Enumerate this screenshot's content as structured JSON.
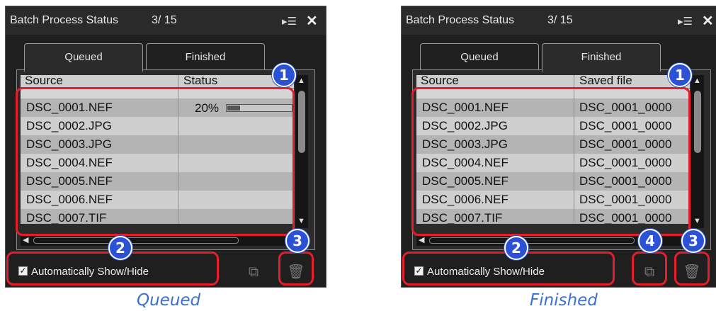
{
  "colors": {
    "highlight": "#e41e2b",
    "badge": "#2a51d6",
    "caption": "#3b6fd6"
  },
  "panels": [
    {
      "title": "Batch Process Status",
      "count": "3/ 15",
      "menu_icon": "▸☰",
      "close_icon": "✕",
      "tabs": [
        "Queued",
        "Finished"
      ],
      "active_tab": 0,
      "columns": [
        "Source",
        "Status"
      ],
      "rows": [
        {
          "source": "DSC_0001.NEF",
          "value": ""
        },
        {
          "source": "DSC_0002.JPG",
          "value": ""
        },
        {
          "source": "DSC_0003.JPG",
          "value": ""
        },
        {
          "source": "DSC_0004.NEF",
          "value": ""
        },
        {
          "source": "DSC_0005.NEF",
          "value": ""
        },
        {
          "source": "DSC_0006.NEF",
          "value": ""
        },
        {
          "source": "DSC_0007.TIF",
          "value": ""
        }
      ],
      "progress": {
        "label": "20%",
        "fraction": 0.2
      },
      "auto_label": "Automatically Show/Hide",
      "badges": [
        "1",
        "2",
        "3"
      ],
      "caption": "Queued"
    },
    {
      "title": "Batch Process Status",
      "count": "3/ 15",
      "menu_icon": "▸☰",
      "close_icon": "✕",
      "tabs": [
        "Queued",
        "Finished"
      ],
      "active_tab": 1,
      "columns": [
        "Source",
        "Saved file"
      ],
      "rows": [
        {
          "source": "DSC_0001.NEF",
          "value": "DSC_0001_0000"
        },
        {
          "source": "DSC_0002.JPG",
          "value": "DSC_0001_0000"
        },
        {
          "source": "DSC_0003.JPG",
          "value": "DSC_0001_0000"
        },
        {
          "source": "DSC_0004.NEF",
          "value": "DSC_0001_0000"
        },
        {
          "source": "DSC_0005.NEF",
          "value": "DSC_0001_0000"
        },
        {
          "source": "DSC_0006.NEF",
          "value": "DSC_0001_0000"
        },
        {
          "source": "DSC_0007.TIF",
          "value": "DSC_0001_0000"
        }
      ],
      "auto_label": "Automatically Show/Hide",
      "badges": [
        "1",
        "2",
        "4",
        "3"
      ],
      "caption": "Finished"
    }
  ]
}
